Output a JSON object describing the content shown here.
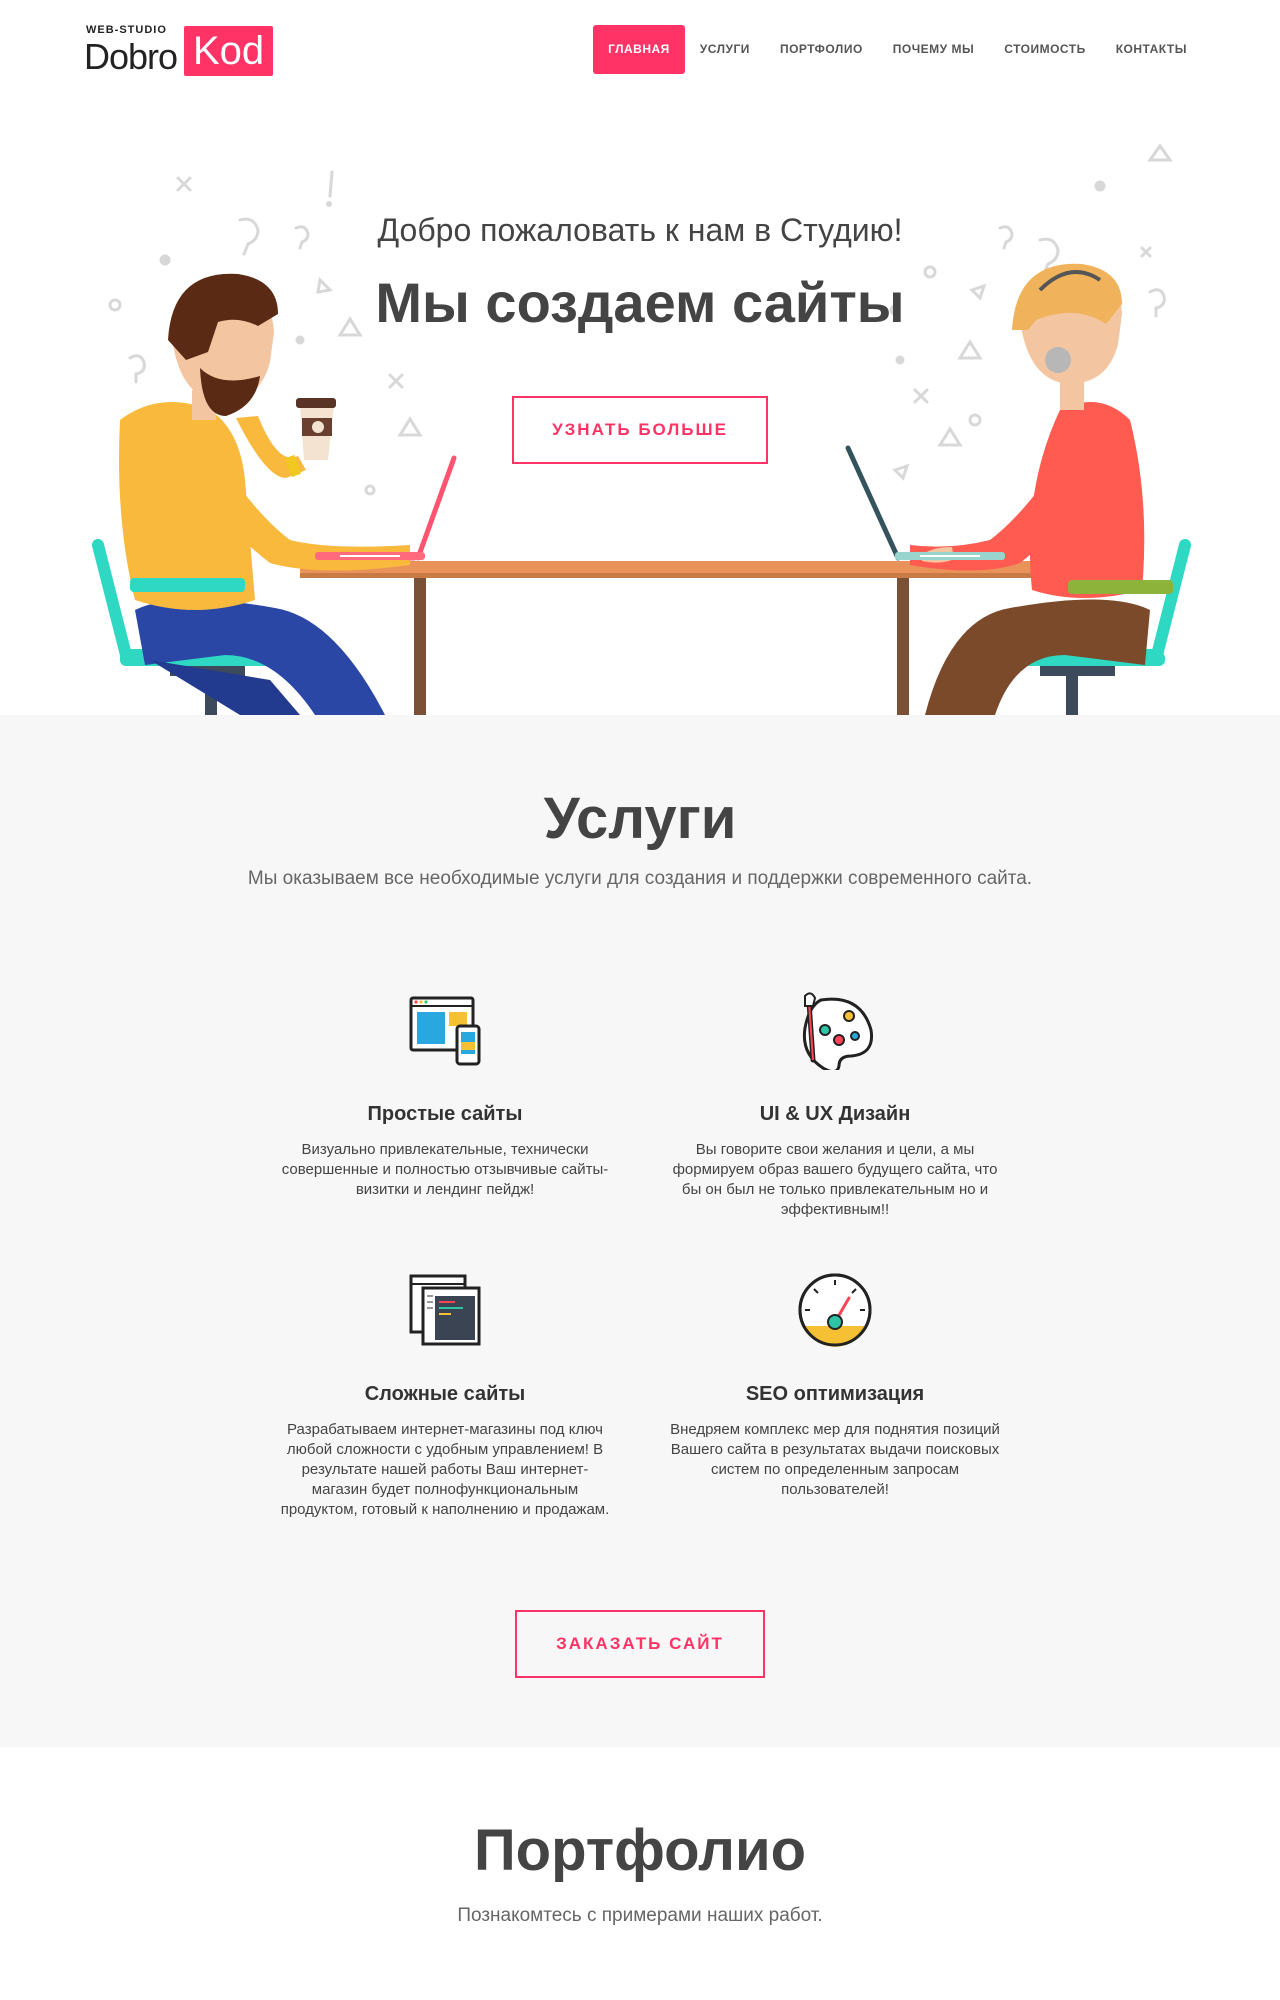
{
  "header": {
    "logo": {
      "sub": "WEB-STUDIO",
      "main": "Dobro",
      "accent": "Kod"
    },
    "nav": [
      {
        "label": "ГЛАВНАЯ",
        "active": true
      },
      {
        "label": "УСЛУГИ"
      },
      {
        "label": "ПОРТФОЛИО"
      },
      {
        "label": "ПОЧЕМУ МЫ"
      },
      {
        "label": "СТОИМОСТЬ"
      },
      {
        "label": "КОНТАКТЫ"
      }
    ]
  },
  "hero": {
    "subtitle": "Добро пожаловать к нам в Студию!",
    "title": "Мы создаем сайты",
    "button": "УЗНАТЬ БОЛЬШЕ"
  },
  "services": {
    "title": "Услуги",
    "lead": "Мы оказываем все необходимые услуги для создания и поддержки современного сайта.",
    "items": [
      {
        "icon": "responsive-devices-icon",
        "name": "Простые сайты",
        "desc": "Визуально привлекательные, технически совершенные и полностью отзывчивые сайты-визитки и лендинг пейдж!"
      },
      {
        "icon": "paint-palette-icon",
        "name": "UI & UX Дизайн",
        "desc": "Вы говорите свои желания и цели, а мы формируем образ вашего будущего сайта, что бы он был не только привлекательным но и эффективным!!"
      },
      {
        "icon": "code-window-icon",
        "name": "Сложные сайты",
        "desc": "Разрабатываем интернет-магазины под ключ любой сложности с удобным управлением! В результате нашей работы Ваш интернет-магазин будет полнофункциональным продуктом, готовый к наполнению и продажам."
      },
      {
        "icon": "speedometer-icon",
        "name": "SEO оптимизация",
        "desc": "Внедряем комплекс мер для поднятия позиций Вашего сайта в результатах выдачи поисковых систем по определенным запросам пользователей!"
      }
    ],
    "button": "ЗАКАЗАТЬ САЙТ"
  },
  "portfolio": {
    "title": "Портфолио",
    "lead": "Познакомтесь с примерами наших работ."
  },
  "colors": {
    "accent": "#ff3366",
    "text": "#444444",
    "section_bg": "#f7f7f7"
  }
}
